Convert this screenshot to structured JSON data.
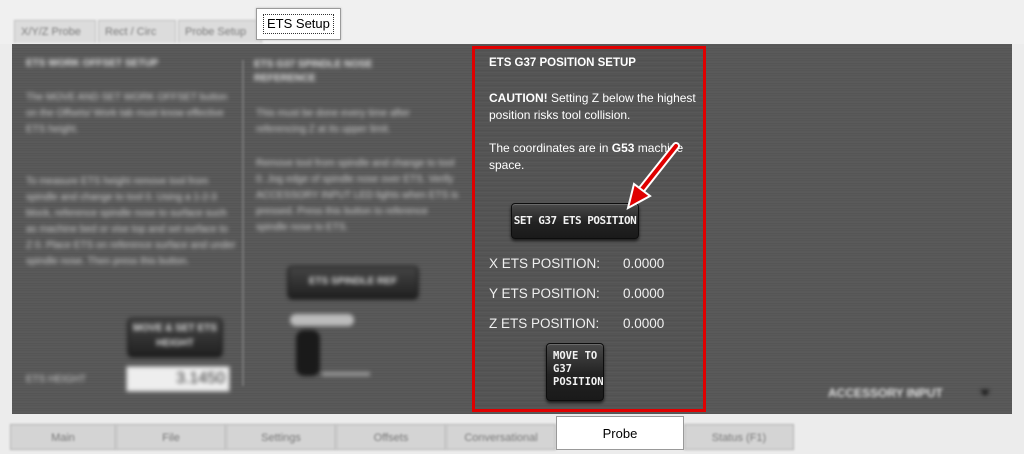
{
  "sub_tabs": [
    {
      "label": "X/Y/Z Probe"
    },
    {
      "label": "Rect / Circ"
    },
    {
      "label": "Probe Setup"
    }
  ],
  "sub_tab_active": {
    "label": "ETS Setup"
  },
  "work_offset_col": {
    "title": "ETS WORK OFFSET SETUP",
    "text": "The MOVE AND SET WORK OFFSET button on the Offsets/ Work tab must know effective ETS height.",
    "text2": "To measure ETS height remove tool from spindle and change to tool 0. Using a 1-2-3 block, reference spindle nose to surface such as machine bed or vise top and set surface to Z 0. Place ETS on reference surface and under spindle nose. Then press this button.",
    "button": "MOVE & SET ETS HEIGHT",
    "height_label": "ETS HEIGHT",
    "height_value": "3.1450"
  },
  "spindle_col": {
    "title": "ETS G37 SPINDLE NOSE REFERENCE",
    "text": "This must be done every time after referencing Z at its upper limit.",
    "text2": "Remove tool from spindle and change to tool 0. Jog edge of spindle nose over ETS. Verify ACCESSORY INPUT LED lights when ETS is pressed. Press this button to reference spindle nose to ETS.",
    "button": "ETS SPINDLE REF"
  },
  "g37": {
    "title": "ETS G37 POSITION SETUP",
    "caution_bold": "CAUTION!",
    "caution_text": " Setting Z below the highest position risks tool collision.",
    "coords_text": "The coordinates are in ",
    "coords_bold": "G53",
    "coords_tail": " machine space.",
    "set_button": "SET G37 ETS POSITION",
    "positions": [
      {
        "label": "X ETS POSITION:",
        "value": "0.0000"
      },
      {
        "label": "Y ETS POSITION:",
        "value": "0.0000"
      },
      {
        "label": "Z ETS POSITION:",
        "value": "0.0000"
      }
    ],
    "move_button_l1": "MOVE TO",
    "move_button_l2": "G37",
    "move_button_l3": "POSITION"
  },
  "accessory_input": "ACCESSORY INPUT",
  "bottom_tabs": [
    {
      "label": "Main"
    },
    {
      "label": "File"
    },
    {
      "label": "Settings"
    },
    {
      "label": "Offsets"
    },
    {
      "label": "Conversational"
    },
    {
      "label": "Status (F1)"
    }
  ],
  "bottom_tab_active": {
    "label": "Probe"
  },
  "colors": {
    "highlight": "#e00000",
    "panel": "#565656"
  }
}
